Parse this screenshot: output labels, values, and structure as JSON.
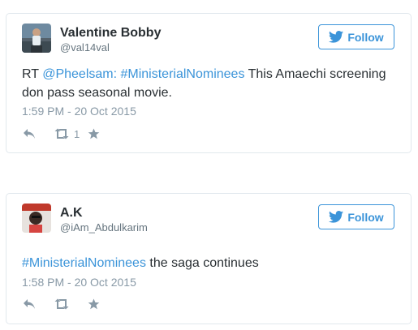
{
  "tweets": [
    {
      "user_name": "Valentine Bobby",
      "user_handle": "@val14val",
      "follow_label": "Follow",
      "text_prefix": "RT ",
      "mention": "@Pheelsam:",
      "hashtag": "#MinisterialNominees",
      "text_suffix": " This Amaechi screening don pass seasonal movie.",
      "timestamp": "1:59 PM - 20 Oct 2015",
      "retweet_count": "1",
      "avatar_icon": "person-photo-icon"
    },
    {
      "user_name": "A.K",
      "user_handle": "@iAm_Abdulkarim",
      "follow_label": "Follow",
      "hashtag": "#MinisterialNominees",
      "text_suffix": " the saga continues",
      "timestamp": "1:58 PM - 20 Oct 2015",
      "avatar_icon": "person-photo-icon"
    }
  ],
  "colors": {
    "link_blue": "#3b94d9",
    "text_dark": "#292f33",
    "text_gray": "#66757f",
    "meta_gray": "#8899a6",
    "border": "#e1e8ed"
  }
}
